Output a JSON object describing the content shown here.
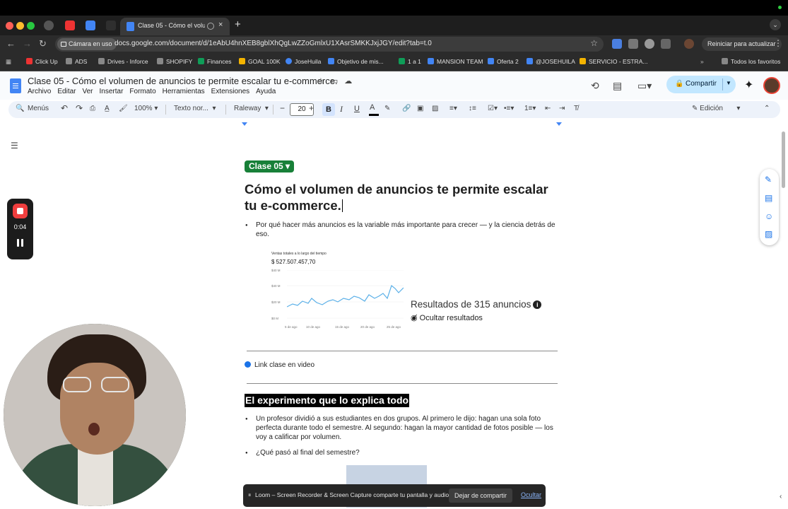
{
  "browser": {
    "active_tab_title": "Clase 05 - Cómo el volum",
    "url": "docs.google.com/document/d/1eAbU4hnXEB8gblXhQgLwZZoGmlxU1XAsrSMKKJxjJGY/edit?tab=t.0",
    "camera_chip": "Cámara en uso",
    "relaunch_label": "Reiniciar para actualizar",
    "bookmarks": [
      "Click Up",
      "ADS",
      "Drives - Inforce",
      "SHOPIFY",
      "Finances",
      "GOAL 100K",
      "JoseHuila",
      "Objetivo de mis...",
      "1 a 1",
      "MANSION TEAM",
      "Oferta 2",
      "@JOSEHUILA",
      "SERVICIO - ESTRA..."
    ],
    "all_favorites": "Todos los favoritos"
  },
  "doc": {
    "title": "Clase 05 - Cómo el volumen de anuncios te permite escalar tu e-commerce.",
    "menu": [
      "Archivo",
      "Editar",
      "Ver",
      "Insertar",
      "Formato",
      "Herramientas",
      "Extensiones",
      "Ayuda"
    ],
    "share_label": "Compartir"
  },
  "toolbar": {
    "menus_label": "Menús",
    "zoom": "100%",
    "style": "Texto nor...",
    "font": "Raleway",
    "font_size": "20",
    "mode": "Edición"
  },
  "content": {
    "chip": "Clase 05",
    "heading": "Cómo el volumen de anuncios te permite escalar tu e-commerce.",
    "bullet1": "Por qué hacer más anuncios es la variable más importante para crecer — y la ciencia detrás de eso.",
    "link_text": "Link clase en video",
    "h2": "El experimento que lo explica todo",
    "bullet2": "Un profesor dividió a sus estudiantes en dos grupos. Al primero le dijo: hagan una sola foto perfecta durante todo el semestre. Al segundo: hagan la mayor cantidad de fotos posible — los voy a calificar por volumen.",
    "bullet3": "¿Qué pasó al final del semestre?"
  },
  "embedded_image": {
    "title": "Ventas totales a lo largo del tiempo",
    "total": "$ 527.507.457,70",
    "y_labels": [
      "$40 M",
      "$40 M",
      "$20 M",
      "$0 M"
    ],
    "x_labels": [
      "5 de ago",
      "10 de ago",
      "15 de ago",
      "20 de ago",
      "25 de ago"
    ],
    "results": "Resultados de 315 anuncios",
    "hide_results": "Ocultar resultados"
  },
  "loom": {
    "timer": "0:04",
    "share_message": "Loom – Screen Recorder & Screen Capture comparte tu pantalla y audio.",
    "stop_sharing": "Dejar de compartir",
    "hide": "Ocultar"
  }
}
